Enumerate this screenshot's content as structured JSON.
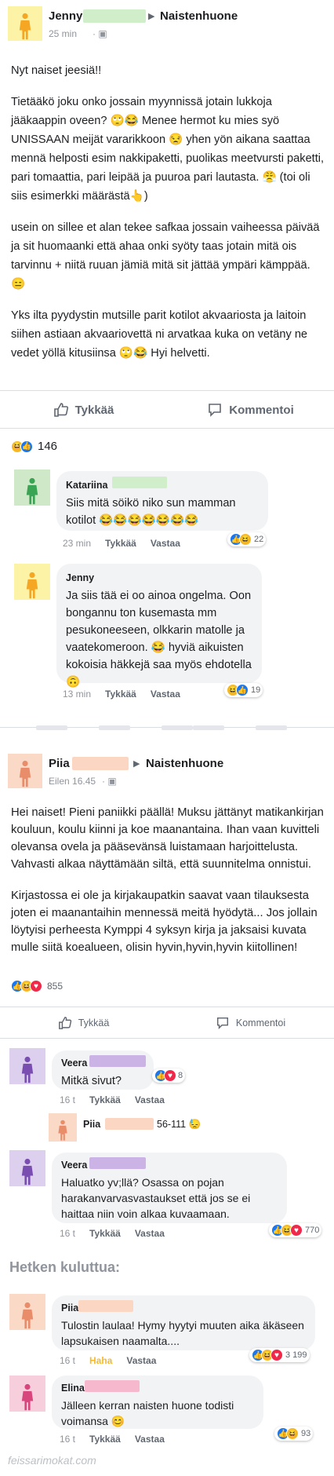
{
  "colors": {
    "avatar_yellow_bg": "#fdf3a6",
    "avatar_yellow_fig": "#f5a623",
    "avatar_green_bg": "#cfe8c8",
    "avatar_green_fig": "#3aa455",
    "avatar_peach_bg": "#fbd9c7",
    "avatar_peach_fig": "#e88c6a",
    "avatar_purple_bg": "#ddd0ee",
    "avatar_purple_fig": "#7a4eb1",
    "avatar_pink_bg": "#f7cfdc",
    "avatar_pink_fig": "#d8467e",
    "redact_green": "#cfeec9",
    "redact_peach": "#fbd7c3",
    "redact_purple": "#cbb3e6",
    "redact_pink": "#f6b8cd"
  },
  "post1": {
    "author": "Jenny",
    "group": "Naistenhuone",
    "time": "25 min",
    "paragraphs": [
      "Nyt naiset jeesiä!!",
      "Tietääkö joku onko jossain myynnissä jotain lukkoja jääkaappin oveen? 🙄😂 Menee hermot ku mies syö UNISSAAN meijät vararikkoon 😒 yhen yön aikana saattaa mennä helposti esim nakkipaketti, puolikas meetvursti paketti, pari tomaattia, pari leipää ja puuroa pari lautasta. 😤 (toi oli siis esimerkki määrästä👆)",
      "usein on sillee et alan tekee safkaa jossain vaiheessa päivää ja sit huomaanki että ahaa onki syöty taas jotain mitä ois tarvinnu + niitä ruuan jämiä mitä sit jättää ympäri kämppää. 😑",
      "Yks ilta pyydystin mutsille parit kotilot akvaariosta ja laitoin siihen astiaan akvaariovettä ni arvatkaa kuka on vetäny ne vedet yöllä kitusiinsa 🙄😂 Hyi helvetti."
    ],
    "like_label": "Tykkää",
    "comment_label": "Kommentoi",
    "reaction_count": "146",
    "comments": [
      {
        "author": "Katariina",
        "text": "Siis mitä söikö niko sun mamman kotilot 😂😂😂😂😂😂😂",
        "time": "23 min",
        "like": "Tykkää",
        "reply": "Vastaa",
        "reactions": "22"
      },
      {
        "author": "Jenny",
        "text": "Ja siis tää ei oo ainoa ongelma. Oon bongannu ton kusemasta mm pesukoneeseen, olkkarin matolle ja vaatekomeroon. 😂 hyviä aikuisten kokoisia häkkejä saa myös ehdotella 🙃",
        "time": "13 min",
        "like": "Tykkää",
        "reply": "Vastaa",
        "reactions": "19"
      }
    ]
  },
  "post2": {
    "author": "Piia",
    "group": "Naistenhuone",
    "time": "Eilen 16.45",
    "paragraphs": [
      "Hei naiset! Pieni paniikki päällä! Muksu jättänyt matikankirjan kouluun, koulu kiinni ja koe maanantaina. Ihan vaan kuvitteli olevansa ovela ja pääsevänsä luistamaan harjoittelusta. Vahvasti alkaa näyttämään siltä, että suunnitelma onnistui.",
      "Kirjastossa ei ole ja kirjakaupatkin saavat vaan tilauksesta joten ei maanantaihin mennessä meitä hyödytä... Jos jollain löytyisi perheesta Kymppi 4 syksyn kirja ja jaksaisi kuvata mulle siitä koealueen, olisin hyvin,hyvin,hyvin kiitollinen!"
    ],
    "reaction_count": "855",
    "like_label": "Tykkää",
    "comment_label": "Kommentoi",
    "comments": [
      {
        "author": "Veera",
        "text": "Mitkä sivut?",
        "time": "16 t",
        "like": "Tykkää",
        "reply": "Vastaa",
        "reactions": "8"
      },
      {
        "author": "Piia",
        "text": "56-111 😓"
      },
      {
        "author": "Veera",
        "text": "Haluatko yv;llä? Osassa on pojan harakanvarvasvastaukset että jos se ei haittaa niin voin alkaa kuvaamaan.",
        "time": "16 t",
        "like": "Tykkää",
        "reply": "Vastaa",
        "reactions": "770"
      }
    ],
    "interlude": "Hetken kuluttua:",
    "later_comments": [
      {
        "author": "Piia",
        "text": "Tulostin laulaa! Hymy hyytyi muuten aika äkäseen lapsukaisen naamalta....",
        "time": "16 t",
        "like": "Haha",
        "reply": "Vastaa",
        "reactions": "3 199"
      },
      {
        "author": "Elina",
        "text": "Jälleen kerran naisten huone todisti voimansa 😊",
        "time": "16 t",
        "like": "Tykkää",
        "reply": "Vastaa",
        "reactions": "93"
      }
    ]
  },
  "watermark": "feissarimokat.com"
}
